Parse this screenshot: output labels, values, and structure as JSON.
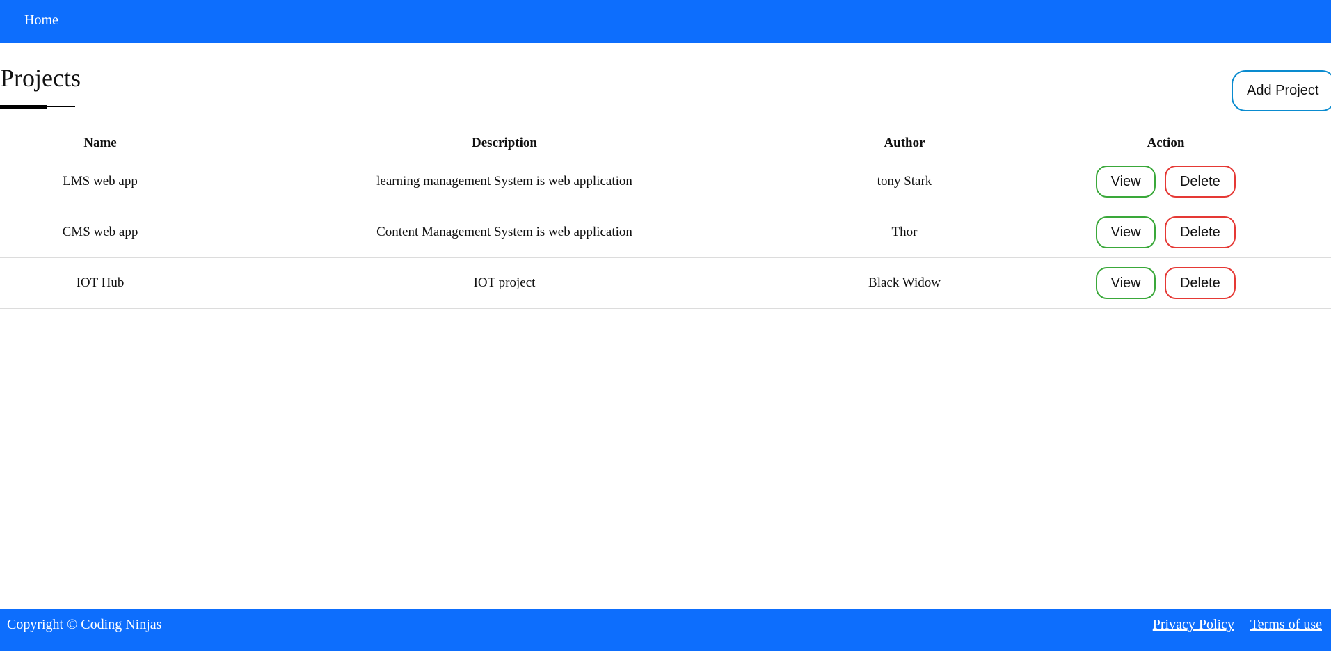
{
  "nav": {
    "home_label": "Home"
  },
  "page": {
    "title": "Projects",
    "add_button_label": "Add Project"
  },
  "table": {
    "headers": [
      "Name",
      "Description",
      "Author",
      "Action"
    ],
    "rows": [
      {
        "name": "LMS web app",
        "description": "learning management System is web application",
        "author": "tony Stark",
        "view_label": "View",
        "delete_label": "Delete"
      },
      {
        "name": "CMS web app",
        "description": "Content Management System is web application",
        "author": "Thor",
        "view_label": "View",
        "delete_label": "Delete"
      },
      {
        "name": "IOT Hub",
        "description": "IOT project",
        "author": "Black Widow",
        "view_label": "View",
        "delete_label": "Delete"
      }
    ]
  },
  "footer": {
    "copyright": "Copyright © Coding Ninjas",
    "links": [
      "Privacy Policy",
      "Terms of use"
    ]
  },
  "colors": {
    "brand_blue": "#0d6efd",
    "view_border": "#3aa83a",
    "delete_border": "#e53935",
    "add_border": "#0a8bcf"
  }
}
